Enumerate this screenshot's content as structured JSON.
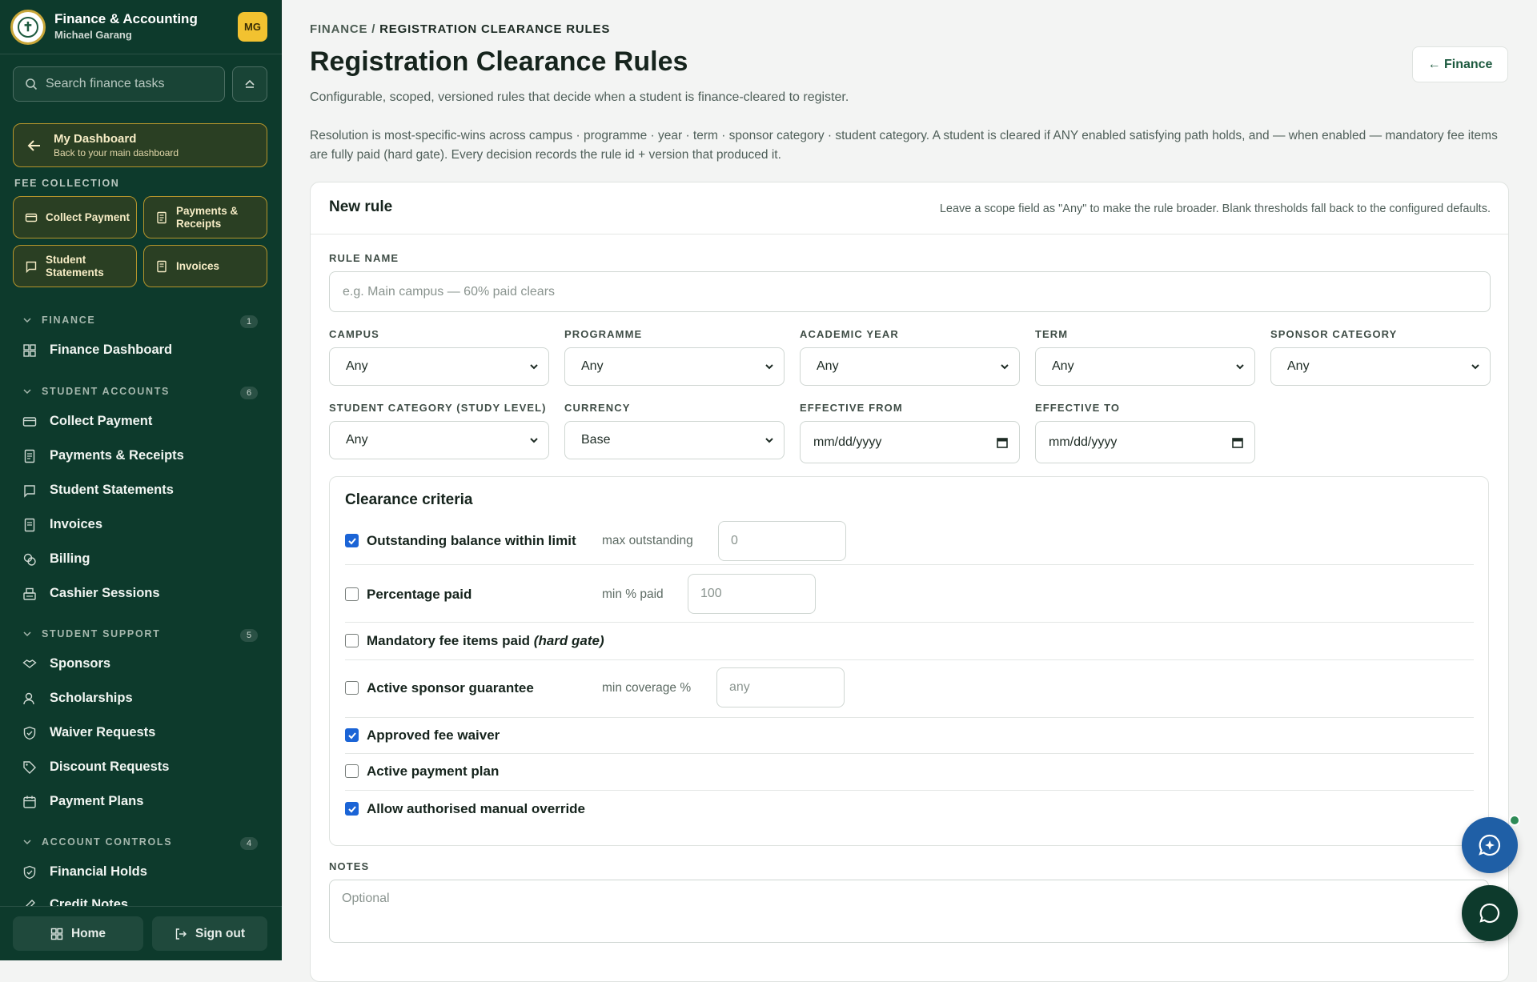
{
  "sidebar": {
    "app_name": "Finance & Accounting",
    "user_name": "Michael Garang",
    "avatar_initials": "MG",
    "search_placeholder": "Search finance tasks",
    "dashboard": {
      "title": "My Dashboard",
      "subtitle": "Back to your main dashboard"
    },
    "fee_collection_label": "FEE COLLECTION",
    "quick_actions": [
      {
        "label": "Collect Payment",
        "icon": "card-icon"
      },
      {
        "label": "Payments & Receipts",
        "icon": "receipt-icon"
      },
      {
        "label": "Student Statements",
        "icon": "statement-icon"
      },
      {
        "label": "Invoices",
        "icon": "invoice-icon"
      }
    ],
    "sections": [
      {
        "title": "FINANCE",
        "count": "1",
        "items": [
          "Finance Dashboard"
        ]
      },
      {
        "title": "STUDENT ACCOUNTS",
        "count": "6",
        "items": [
          "Collect Payment",
          "Payments & Receipts",
          "Student Statements",
          "Invoices",
          "Billing",
          "Cashier Sessions"
        ]
      },
      {
        "title": "STUDENT SUPPORT",
        "count": "5",
        "items": [
          "Sponsors",
          "Scholarships",
          "Waiver Requests",
          "Discount Requests",
          "Payment Plans"
        ]
      },
      {
        "title": "ACCOUNT CONTROLS",
        "count": "4",
        "items": [
          "Financial Holds",
          "Credit Notes"
        ]
      }
    ],
    "footer": {
      "home": "Home",
      "sign_out": "Sign out"
    }
  },
  "header": {
    "breadcrumb_root": "FINANCE",
    "breadcrumb_sep": " / ",
    "breadcrumb_current": "REGISTRATION CLEARANCE RULES",
    "title": "Registration Clearance Rules",
    "subtitle": "Configurable, scoped, versioned rules that decide when a student is finance-cleared to register.",
    "description": "Resolution is most-specific-wins across campus · programme · year · term · sponsor category · student category. A student is cleared if ANY enabled satisfying path holds, and — when enabled — mandatory fee items are fully paid (hard gate). Every decision records the rule id + version that produced it.",
    "back_button": "← Finance"
  },
  "form": {
    "card_title": "New rule",
    "card_hint": "Leave a scope field as \"Any\" to make the rule broader. Blank thresholds fall back to the configured defaults.",
    "rule_name_label": "RULE NAME",
    "rule_name_placeholder": "e.g. Main campus — 60% paid clears",
    "scope": [
      {
        "label": "CAMPUS",
        "value": "Any"
      },
      {
        "label": "PROGRAMME",
        "value": "Any"
      },
      {
        "label": "ACADEMIC YEAR",
        "value": "Any"
      },
      {
        "label": "TERM",
        "value": "Any"
      },
      {
        "label": "SPONSOR CATEGORY",
        "value": "Any"
      },
      {
        "label": "STUDENT CATEGORY (STUDY LEVEL)",
        "value": "Any"
      },
      {
        "label": "CURRENCY",
        "value": "Base"
      }
    ],
    "effective_from_label": "EFFECTIVE FROM",
    "effective_to_label": "EFFECTIVE TO",
    "date_placeholder": "mm/dd/yyyy",
    "criteria_title": "Clearance criteria",
    "criteria": [
      {
        "label": "Outstanding balance within limit",
        "checked": true,
        "field_label": "max outstanding",
        "field_placeholder": "0"
      },
      {
        "label": "Percentage paid",
        "checked": false,
        "field_label": "min % paid",
        "field_placeholder": "100"
      },
      {
        "label": "Mandatory fee items paid",
        "label_suffix": "(hard gate)",
        "checked": false
      },
      {
        "label": "Active sponsor guarantee",
        "checked": false,
        "field_label": "min coverage %",
        "field_placeholder": "any"
      },
      {
        "label": "Approved fee waiver",
        "checked": true
      },
      {
        "label": "Active payment plan",
        "checked": false
      },
      {
        "label": "Allow authorised manual override",
        "checked": true
      }
    ],
    "notes_label": "NOTES",
    "notes_placeholder": "Optional"
  },
  "colors": {
    "sidebar_bg": "#0d3a2c",
    "accent_gold": "#b5952c",
    "checkbox_blue": "#1b64d6",
    "fab_blue": "#1f5fa6",
    "fab_green": "#0d3a2c"
  }
}
